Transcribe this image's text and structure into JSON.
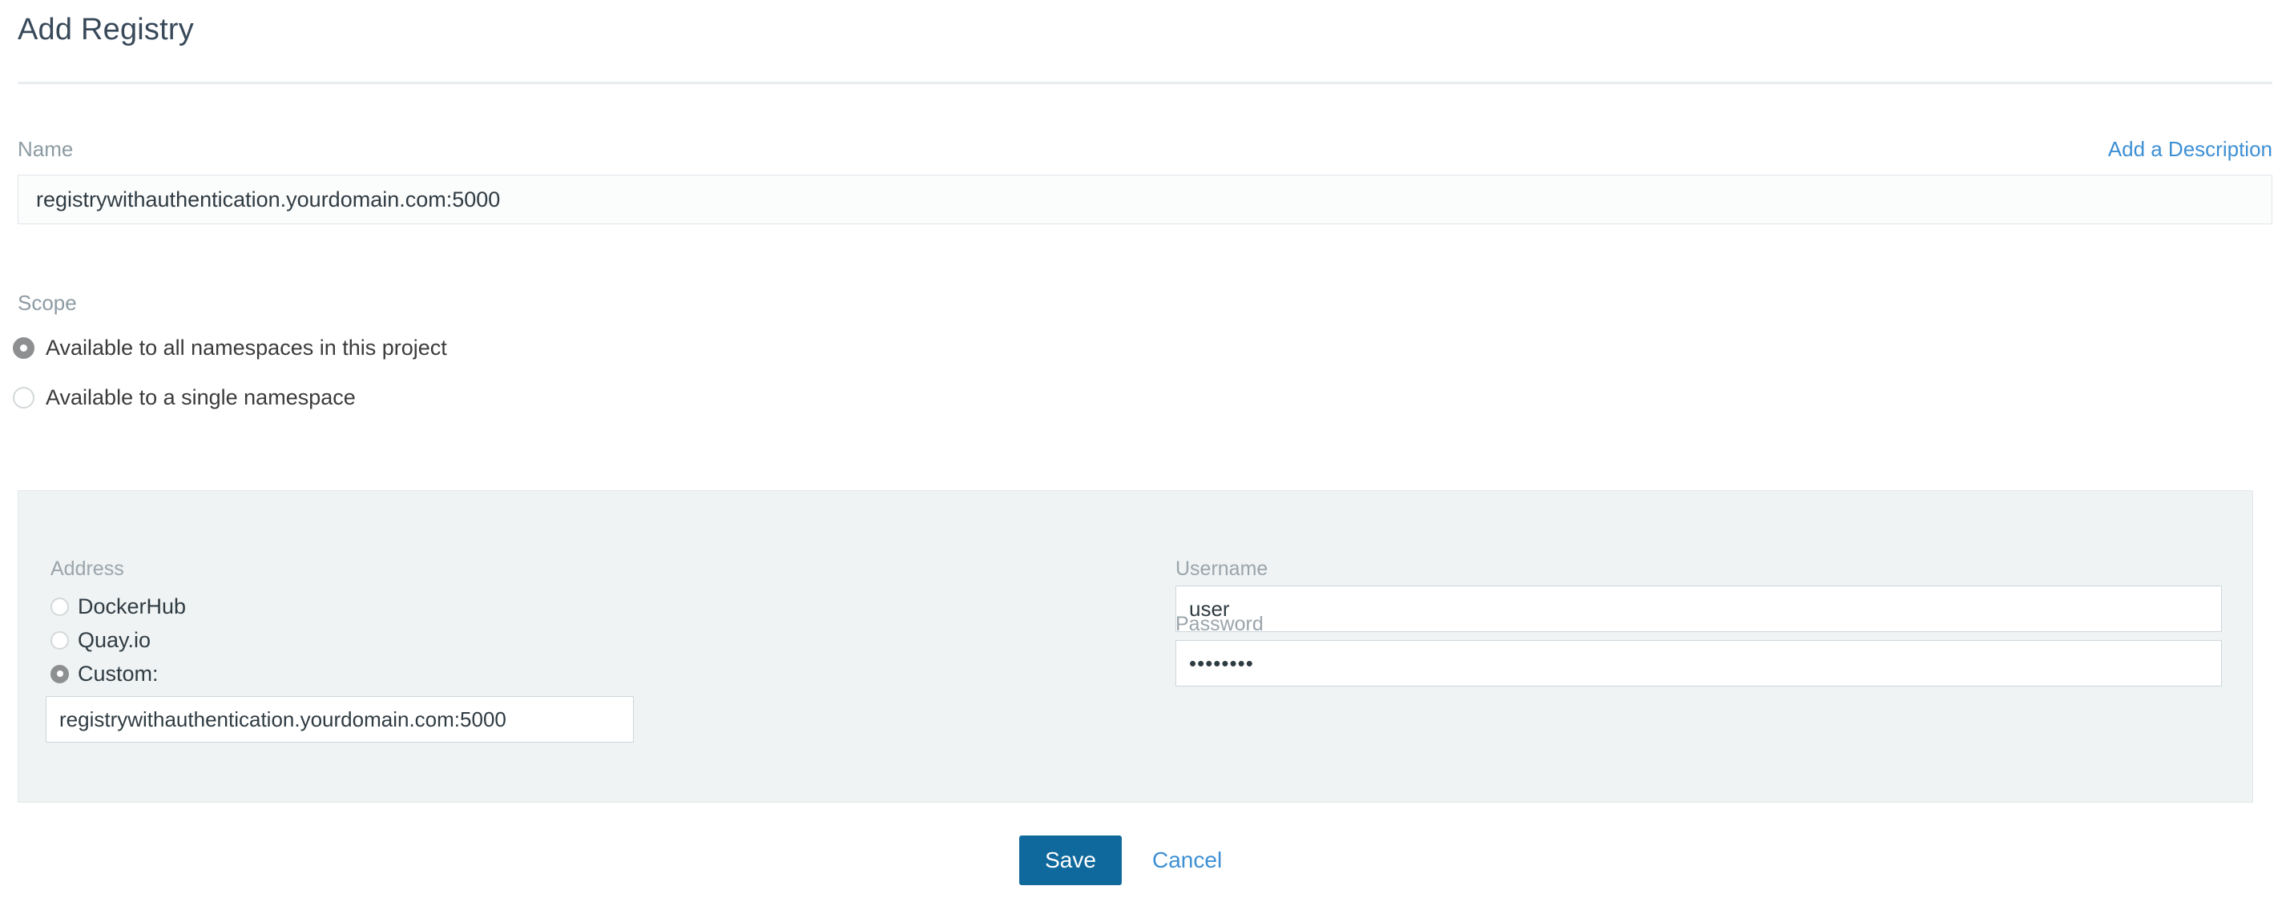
{
  "header": {
    "title": "Add Registry"
  },
  "name_section": {
    "label": "Name",
    "add_description_link": "Add a Description",
    "input_value": "registrywithauthentication.yourdomain.com:5000",
    "input_placeholder": ""
  },
  "scope_section": {
    "label": "Scope",
    "options": [
      {
        "label": "Available to all namespaces in this project",
        "selected": true
      },
      {
        "label": "Available to a single namespace",
        "selected": false
      }
    ]
  },
  "credentials_panel": {
    "address": {
      "label": "Address",
      "options": [
        {
          "label": "DockerHub",
          "selected": false
        },
        {
          "label": "Quay.io",
          "selected": false
        },
        {
          "label": "Custom:",
          "selected": true
        }
      ],
      "custom_value": "registrywithauthentication.yourdomain.com:5000",
      "custom_placeholder": ""
    },
    "username": {
      "label": "Username",
      "value": "user",
      "placeholder": ""
    },
    "password": {
      "label": "Password",
      "value": "••••••••",
      "placeholder": ""
    }
  },
  "footer": {
    "save_label": "Save",
    "cancel_label": "Cancel"
  },
  "colors": {
    "title": "#38495a",
    "link": "#3d8fd4",
    "label": "#8d9ba3",
    "panel_bg": "#eff3f4",
    "primary_button": "#10699c",
    "radio_selected": "#8d8f91"
  }
}
